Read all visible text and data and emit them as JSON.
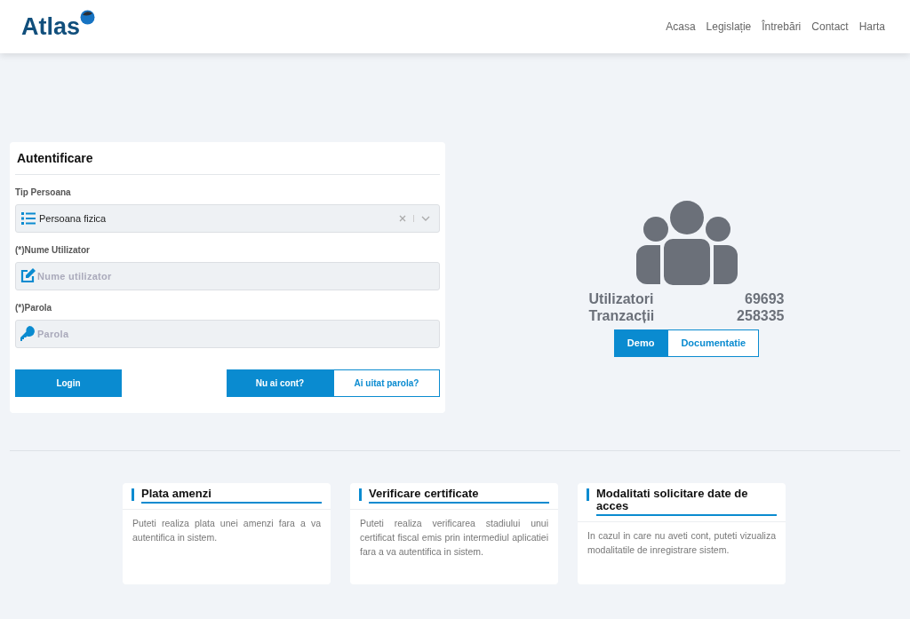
{
  "header": {
    "logo": "Atlas",
    "nav": [
      "Acasa",
      "Legislație",
      "Întrebări",
      "Contact",
      "Harta"
    ]
  },
  "login": {
    "title": "Autentificare",
    "fields": [
      {
        "kind": "select",
        "label": "Tip Persoana",
        "value": "Persoana fizica"
      },
      {
        "kind": "text",
        "label": "(*)Nume Utilizator",
        "placeholder": "Nume utilizator"
      },
      {
        "kind": "password",
        "label": "(*)Parola",
        "placeholder": "Parola"
      }
    ],
    "login_button": "Login",
    "links": [
      {
        "label": "Nu ai cont?",
        "kind": "primary"
      },
      {
        "label": "Ai uitat parola?",
        "kind": "outline"
      }
    ]
  },
  "stats": {
    "rows": [
      {
        "label": "Utilizatori",
        "value": "69693"
      },
      {
        "label": "Tranzacții",
        "value": "258335"
      }
    ],
    "buttons": [
      {
        "label": "Demo",
        "kind": "primary"
      },
      {
        "label": "Documentatie",
        "kind": "outline"
      }
    ]
  },
  "cards": [
    {
      "title": "Plata amenzi",
      "text": "Puteti realiza plata unei amenzi fara a va autentifica in sistem."
    },
    {
      "title": "Verificare certificate",
      "text": "Puteti realiza verificarea stadiului unui certificat fiscal emis prin intermediul aplicatiei fara a va autentifica in sistem."
    },
    {
      "title": "Modalitati solicitare date de acces",
      "text": "In cazul in care nu aveti cont, puteti vizualiza modalitatile de inregistrare sistem."
    }
  ]
}
